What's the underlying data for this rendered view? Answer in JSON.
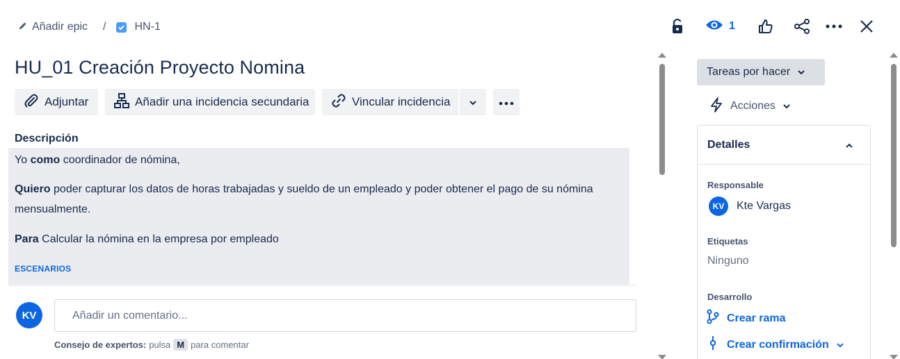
{
  "breadcrumb": {
    "epic_label": "Añadir epic",
    "separator": "/",
    "issue_key": "HN-1"
  },
  "header": {
    "watchers_count": "1",
    "icons": [
      "lock-icon",
      "eye-icon",
      "thumbs-up-icon",
      "share-icon",
      "more-icon",
      "close-icon"
    ]
  },
  "issue": {
    "title": "HU_01 Creación Proyecto Nomina"
  },
  "toolbar": {
    "attach_label": "Adjuntar",
    "add_child_label": "Añadir una incidencia secundaria",
    "link_label": "Vincular incidencia"
  },
  "description": {
    "label": "Descripción",
    "line1_bold": "Yo",
    "line1_bold2": "como",
    "line1_rest": "coordinador de nómina,",
    "line2_bold": "Quiero",
    "line2_rest": "poder capturar los datos de horas trabajadas y sueldo de un empleado y poder obtener el pago de su nómina",
    "line2_cont": "mensualmente.",
    "line3_bold": "Para",
    "line3_rest": "Calcular la nómina en la empresa por empleado",
    "scenarios": "ESCENARIOS"
  },
  "comment": {
    "avatar_initials": "KV",
    "placeholder": "Añadir un comentario...",
    "tip_bold": "Consejo de expertos:",
    "tip_pre": "pulsa",
    "tip_key": "M",
    "tip_post": "para comentar"
  },
  "sidebar": {
    "status_label": "Tareas por hacer",
    "actions_label": "Acciones",
    "details_title": "Detalles",
    "assignee_label": "Responsable",
    "assignee_initials": "KV",
    "assignee_name": "Kte Vargas",
    "labels_label": "Etiquetas",
    "labels_value": "Ninguno",
    "dev_label": "Desarrollo",
    "create_branch": "Crear rama",
    "create_commit": "Crear confirmación"
  },
  "colors": {
    "accent": "#0c66e4",
    "description_bg": "#ebecf0",
    "button_bg": "#f1f2f4",
    "status_bg": "#dcdfe4"
  }
}
